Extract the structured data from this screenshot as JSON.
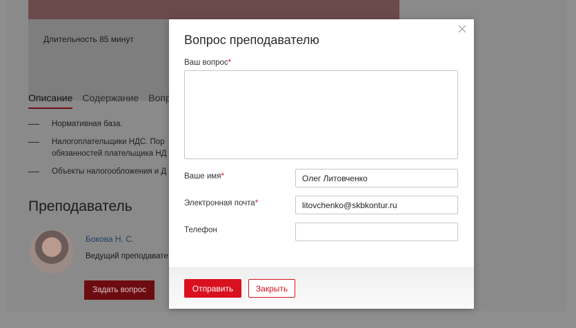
{
  "background": {
    "duration": "Длительность 85 минут",
    "tabs": [
      "Описание",
      "Содержание",
      "Вопр"
    ],
    "description_items": [
      "Нормативная база.",
      "Налогоплательщики НДС. Пор\nобязанностей плательщика НД",
      "Объекты налогообложения и Д"
    ],
    "teacher_section_title": "Преподаватель",
    "teacher_name": "Бокова Н. С.",
    "teacher_role": "Ведущий преподавате",
    "ask_button": "Задать вопрос"
  },
  "modal": {
    "title": "Вопрос преподавателю",
    "close_icon": "close-icon",
    "question_label": "Ваш вопрос",
    "question_value": "",
    "name_label": "Ваше имя",
    "name_value": "Олег Литовченко",
    "email_label": "Электронная почта",
    "email_value": "litovchenko@skbkontur.ru",
    "phone_label": "Телефон",
    "phone_value": "",
    "required_mark": "*",
    "send_button": "Отправить",
    "close_button": "Закрыть"
  },
  "colors": {
    "accent": "#d9101e",
    "accent_dark_dimmed": "#6d0c10"
  }
}
